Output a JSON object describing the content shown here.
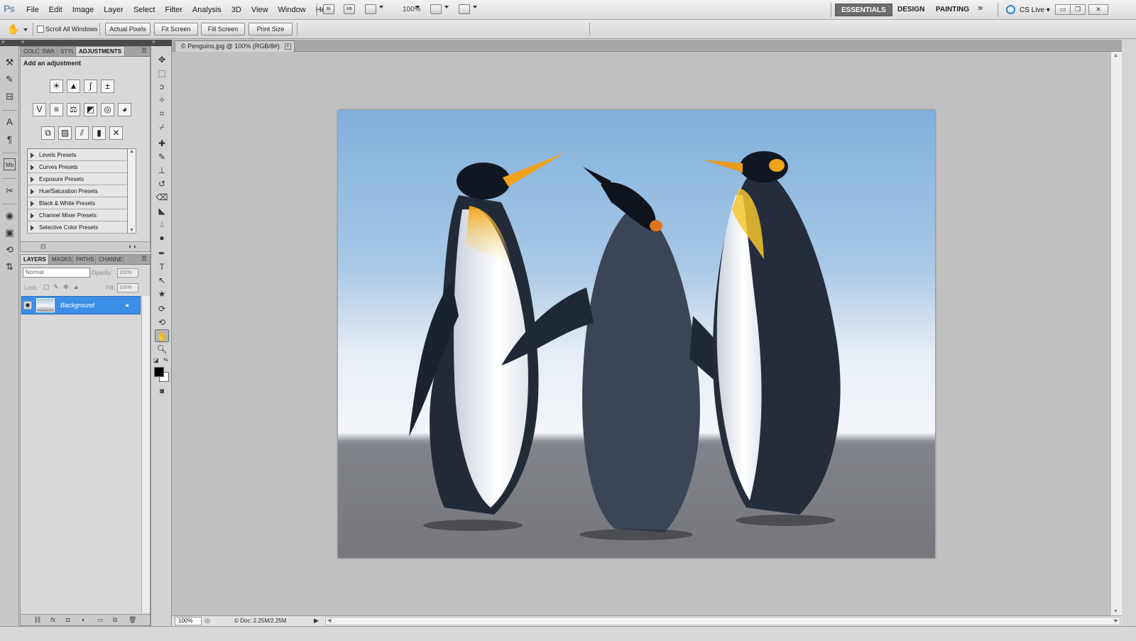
{
  "app": {
    "logo": "Ps",
    "menu": [
      "File",
      "Edit",
      "Image",
      "Layer",
      "Select",
      "Filter",
      "Analysis",
      "3D",
      "View",
      "Window",
      "Help"
    ],
    "mb_icons": [
      "Br",
      "Mb"
    ],
    "zoom_level": "100%",
    "workspaces": [
      "ESSENTIALS",
      "DESIGN",
      "PAINTING"
    ],
    "more_glyph": "»",
    "cslive": "CS Live ▾",
    "window_controls": [
      "▭",
      "❐",
      "✕"
    ]
  },
  "options_bar": {
    "scroll_all_windows": "Scroll All Windows",
    "buttons": [
      "Actual Pixels",
      "Fit Screen",
      "Fill Screen",
      "Print Size"
    ]
  },
  "adjustments_panel": {
    "tabs": [
      "COLO",
      "SWA",
      "STYL",
      "ADJUSTMENTS"
    ],
    "title": "Add an adjustment",
    "presets": [
      "Levels Presets",
      "Curves Presets",
      "Exposure Presets",
      "Hue/Saturation Presets",
      "Black & White Presets",
      "Channel Mixer Presets",
      "Selective Color Presets"
    ]
  },
  "layers_panel": {
    "tabs": [
      "LAYERS",
      "MASKS",
      "PATHS",
      "CHANNE"
    ],
    "blend_mode": "Normal",
    "opacity_label": "Opacity:",
    "opacity_value": "100%",
    "lock_label": "Lock:",
    "fill_label": "Fill:",
    "fill_value": "100%",
    "layers": [
      {
        "name": "Background",
        "visible": true,
        "locked": true
      }
    ]
  },
  "document": {
    "tab_title": "© Penguins.jpg @ 100% (RGB/8#)",
    "zoom": "100%",
    "doc_info": "© Doc: 2.25M/2.25M"
  },
  "colors": {
    "workspace_active": "#6c6c6c",
    "layer_selected": "#3b8fe8",
    "canvas_bg": "#c0c0c0"
  }
}
